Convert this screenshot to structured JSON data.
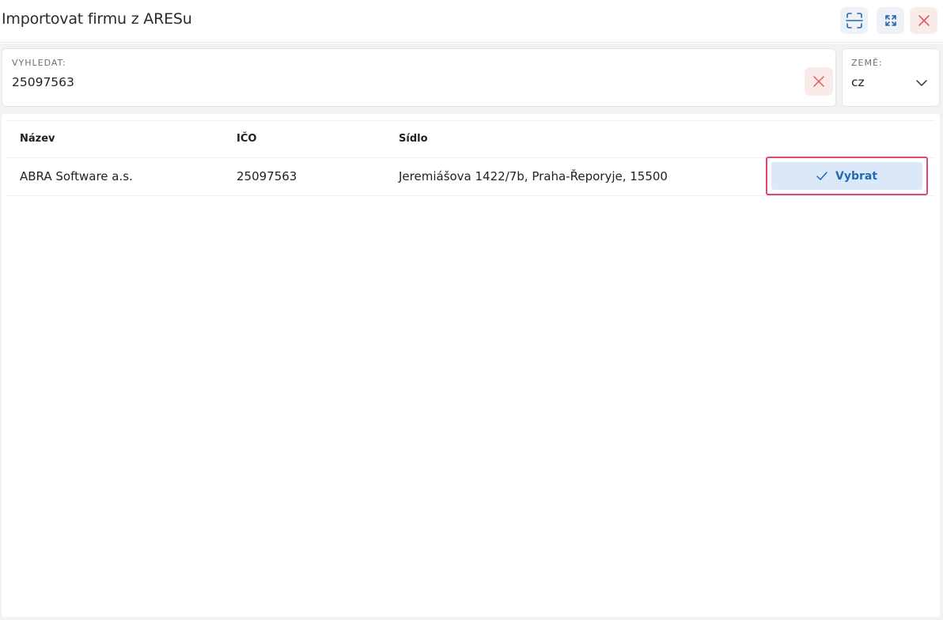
{
  "window": {
    "title": "Importovat firmu z ARESu",
    "colors": {
      "accent": "#2467b3",
      "danger": "#e0486f",
      "close": "#e25c5c"
    }
  },
  "toolbar": {
    "scan_icon": "scan-icon",
    "maximize_icon": "maximize-icon",
    "close_icon": "close-icon"
  },
  "search": {
    "label": "VYHLEDAT:",
    "value": "25097563",
    "clear_icon": "clear-icon"
  },
  "country": {
    "label": "ZEMĚ:",
    "value": "cz",
    "dropdown_icon": "chevron-down-icon"
  },
  "table": {
    "headers": [
      "Název",
      "IČO",
      "Sídlo"
    ],
    "rows": [
      {
        "name": "ABRA Software a.s.",
        "ico": "25097563",
        "address": "Jeremiášova 1422/7b, Praha-Řeporyje, 15500",
        "action_label": "Vybrat"
      }
    ]
  }
}
